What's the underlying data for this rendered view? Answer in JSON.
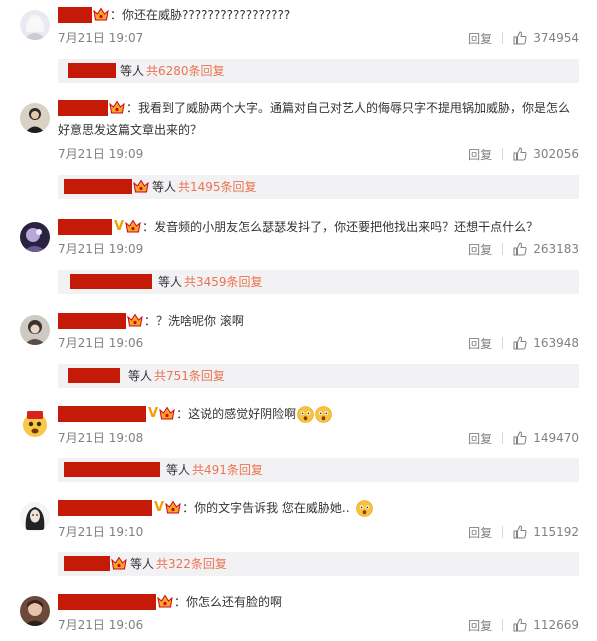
{
  "ui": {
    "reply_label": "回复",
    "sub_prefix": "等人",
    "colon": "："
  },
  "comments": [
    {
      "text": "你还在威胁?????????????????",
      "text2": "",
      "time": "7月21日 19:07",
      "likes": "374954",
      "sub_count": "共6280条回复"
    },
    {
      "text": "我看到了威胁两个大字。通篇对自己对艺人的侮辱只字不提甩锅加威胁，你是怎么",
      "text2": "好意思发这篇文章出来的？",
      "time": "7月21日 19:09",
      "likes": "302056",
      "sub_count": "共1495条回复"
    },
    {
      "text": "发音频的小朋友怎么瑟瑟发抖了，你还要把他找出来吗？还想干点什么？",
      "text2": "",
      "time": "7月21日 19:09",
      "likes": "263183",
      "sub_count": "共3459条回复"
    },
    {
      "text": "？洗啥呢你 滚啊",
      "text2": "",
      "time": "7月21日 19:06",
      "likes": "163948",
      "sub_count": "共751条回复"
    },
    {
      "text": "这说的感觉好阴险啊",
      "text2": "",
      "time": "7月21日 19:08",
      "likes": "149470",
      "sub_count": "共491条回复"
    },
    {
      "text": "你的文字告诉我 您在威胁她..",
      "text2": "",
      "time": "7月21日 19:10",
      "likes": "115192",
      "sub_count": "共322条回复"
    },
    {
      "text": "你怎么还有脸的啊",
      "text2": "",
      "time": "7月21日 19:06",
      "likes": "112669",
      "sub_count": ""
    }
  ],
  "colors": {
    "redaction": "#c61a09",
    "link": "#eb7350",
    "muted": "#808080",
    "sub_bg": "#f2f2f5",
    "vip": "#f0a000"
  },
  "icons": {
    "crown": "vip-crown-icon",
    "like": "thumbs-up-icon",
    "vip": "verified-v-icon",
    "emoji": "fearful-face-emoji"
  }
}
